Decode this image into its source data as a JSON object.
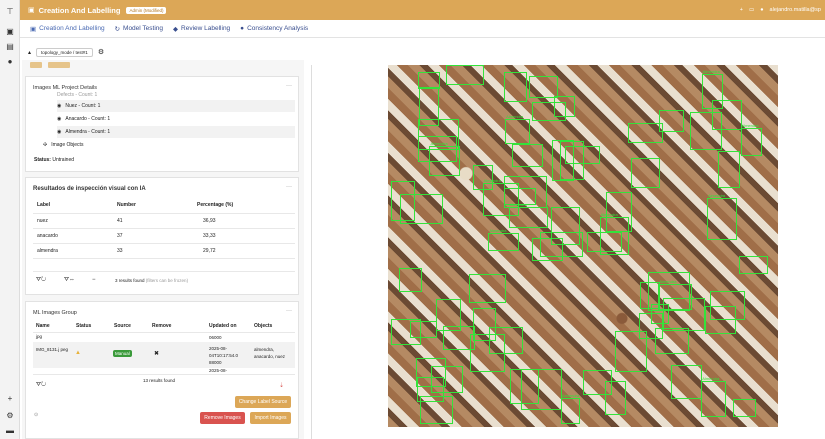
{
  "app": {
    "title": "Creation And Labelling",
    "badge": "Admin (Modified)",
    "user": "alejandro.matilla@sp"
  },
  "tabs": [
    {
      "label": "Creation And Labelling",
      "icon": "image-icon"
    },
    {
      "label": "Model Testing",
      "icon": "refresh-icon"
    },
    {
      "label": "Review Labelling",
      "icon": "tag-icon"
    },
    {
      "label": "Consistency Analysis",
      "icon": "group-icon"
    }
  ],
  "toolbar": {
    "project_select": "topology_mode / test#1"
  },
  "details": {
    "title": "Images ML Project Details",
    "partial_row": "Defects - Count: 1",
    "objects": [
      {
        "label": "Nuez - Count: 1"
      },
      {
        "label": "Anacardo - Count: 1"
      },
      {
        "label": "Almendra - Count: 1"
      }
    ],
    "image_objects": "Image Objects",
    "status_label": "Status:",
    "status_value": "Untrained"
  },
  "results": {
    "title": "Resultados de inspección visual con IA",
    "headers": [
      "Label",
      "Number",
      "Percentage (%)"
    ],
    "rows": [
      [
        "nuez",
        "41",
        "36,93"
      ],
      [
        "anacardo",
        "37",
        "33,33"
      ],
      [
        "almendra",
        "33",
        "29,72"
      ]
    ],
    "found": "3 results found",
    "found_note": "(filters can be frozen)"
  },
  "group": {
    "title": "ML Images Group",
    "headers": [
      "Name",
      "Status",
      "Source",
      "Remove",
      "Updated on",
      "Objects"
    ],
    "row_prev": {
      "name": "jpg",
      "updated": "06000"
    },
    "row": {
      "name": "IMG_8131.j peg",
      "source": "Manual",
      "updated": "2025-08-04T10:17:54.0 88000",
      "objects": "almendra, anacardo, nuez"
    },
    "row_next": {
      "updated": "2025-08-"
    },
    "found": "13 results found"
  },
  "buttons": {
    "change_label_source": "Change Label Source",
    "remove_images": "Remove Images",
    "import_images": "Import Images"
  },
  "labels": {
    "almendra": "Almendra",
    "anacardo": "Anacardo",
    "nuez": "Nuez"
  },
  "colors": {
    "accent": "#dca757",
    "bbox": "#33e33a",
    "danger": "#d9534f"
  }
}
